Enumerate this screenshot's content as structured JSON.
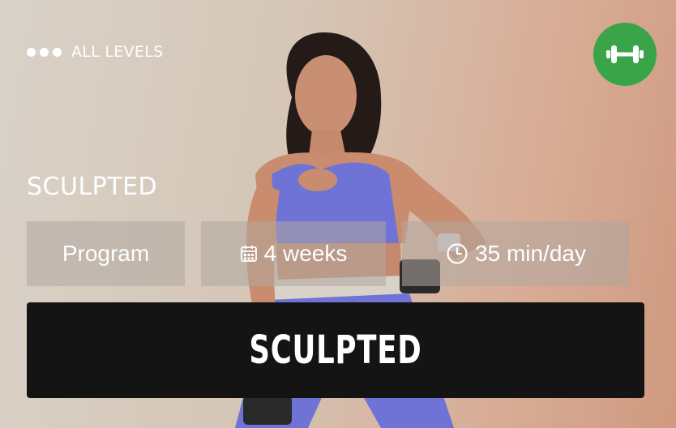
{
  "card": {
    "level_label": "ALL LEVELS",
    "badge_icon": "dumbbell-icon",
    "title": "SCULPTED",
    "chips": [
      {
        "label": "Program",
        "icon": ""
      },
      {
        "label": "4 weeks",
        "icon": "calendar-icon"
      },
      {
        "label": "35 min/day",
        "icon": "clock-icon"
      }
    ],
    "cta_label": "SCULPTED"
  },
  "colors": {
    "badge": "#3aa548",
    "cta": "#141414",
    "outfit": "#6f73d6"
  }
}
